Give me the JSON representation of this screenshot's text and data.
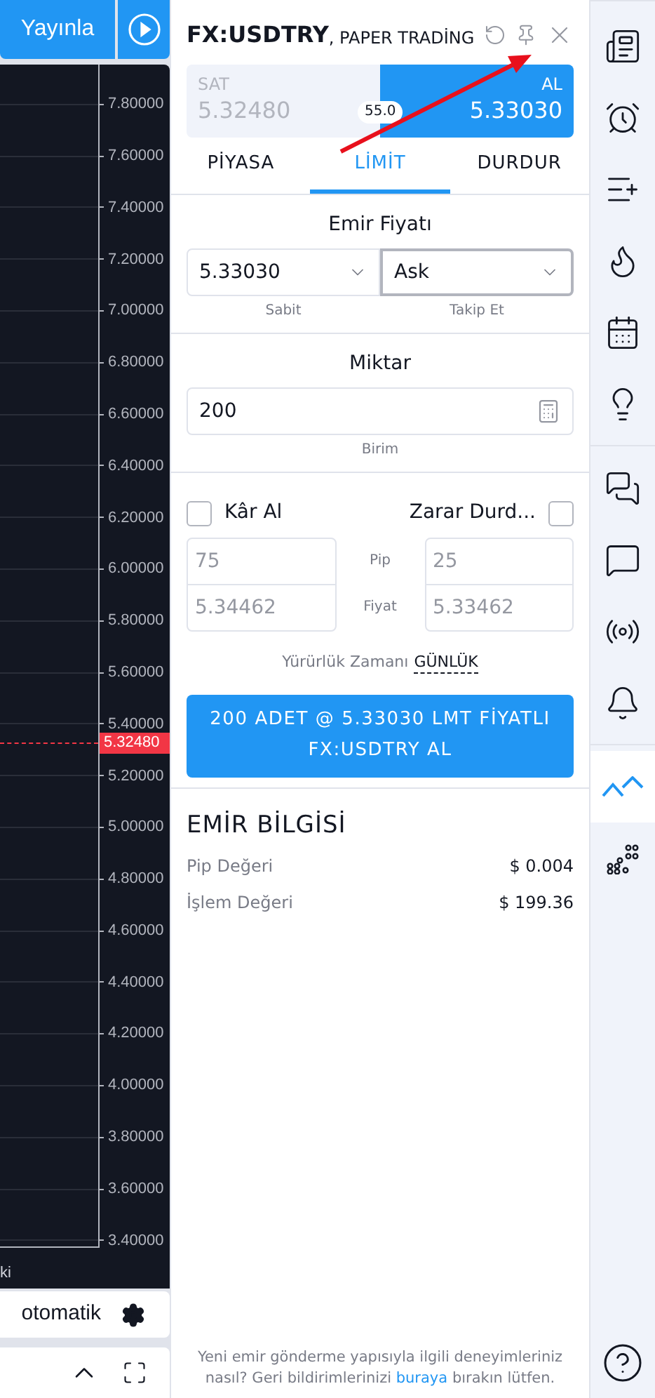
{
  "chart_panel": {
    "publish_button": "Yayınla",
    "price_scale": [
      "7.80000",
      "7.60000",
      "7.40000",
      "7.20000",
      "7.00000",
      "6.80000",
      "6.60000",
      "6.40000",
      "6.20000",
      "6.00000",
      "5.80000",
      "5.60000",
      "5.40000",
      "5.20000",
      "5.00000",
      "4.80000",
      "4.60000",
      "4.40000",
      "4.20000",
      "4.00000",
      "3.80000",
      "3.60000",
      "3.40000"
    ],
    "last_price": "5.32480",
    "footer_text": "ki",
    "scale_mode": "otomatik"
  },
  "order_panel": {
    "symbol": "FX:USDTRY",
    "account": ", PAPER TRADİNG",
    "sell": {
      "label": "SAT",
      "price": "5.32480",
      "selected": false
    },
    "buy": {
      "label": "AL",
      "price": "5.33030",
      "selected": true
    },
    "spread": "55.0",
    "tabs": [
      {
        "label": "PİYASA",
        "selected": false
      },
      {
        "label": "LİMİT",
        "selected": true
      },
      {
        "label": "DURDUR",
        "selected": false
      }
    ],
    "order_price": {
      "label": "Emir Fiyatı",
      "fields": [
        {
          "value": "5.33030",
          "caption": "Sabit",
          "focused": false
        },
        {
          "value": "Ask",
          "caption": "Takip Et",
          "focused": true
        }
      ]
    },
    "quantity": {
      "label": "Miktar",
      "value": "200",
      "caption": "Birim"
    },
    "brackets": [
      {
        "label": "Kâr Al",
        "checked": false,
        "pip": "75",
        "price": "5.34462"
      },
      {
        "label": "Zarar Durd...",
        "checked": false,
        "pip": "25",
        "price": "5.33462"
      }
    ],
    "bracket_row_labels": [
      "Pip",
      "Fiyat"
    ],
    "validity": {
      "label": "Yürürlük Zamanı",
      "value": "GÜNLÜK"
    },
    "submit_button": [
      "200 ADET @ 5.33030 LMT FİYATLI",
      "FX:USDTRY AL"
    ],
    "order_info": {
      "title": "EMİR BİLGİSİ",
      "rows": [
        {
          "label": "Pip Değeri",
          "value": "$ 0.004"
        },
        {
          "label": "İşlem Değeri",
          "value": "$ 199.36"
        }
      ]
    },
    "feedback": {
      "before": "Yeni emir gönderme yapısıyla ilgili deneyimleriniz nasıl? Geri bildirimlerinizi",
      "link": "buraya",
      "after": "bırakın lütfen."
    }
  },
  "right_sidebar": {
    "groups": [
      {
        "items": [
          {
            "kind": "list",
            "selected": false
          },
          {
            "kind": "alarm",
            "selected": false
          },
          {
            "kind": "watchlist",
            "selected": false
          },
          {
            "kind": "hotlist",
            "selected": false
          },
          {
            "kind": "calendar",
            "selected": false
          },
          {
            "kind": "ideas",
            "selected": false
          }
        ]
      },
      {
        "items": [
          {
            "kind": "chats",
            "selected": false
          },
          {
            "kind": "chat",
            "selected": false
          },
          {
            "kind": "streams",
            "selected": false
          },
          {
            "kind": "notifications",
            "selected": false
          }
        ]
      },
      {
        "items": [
          {
            "kind": "trading",
            "selected": true
          },
          {
            "kind": "dom",
            "selected": false
          }
        ]
      }
    ]
  }
}
